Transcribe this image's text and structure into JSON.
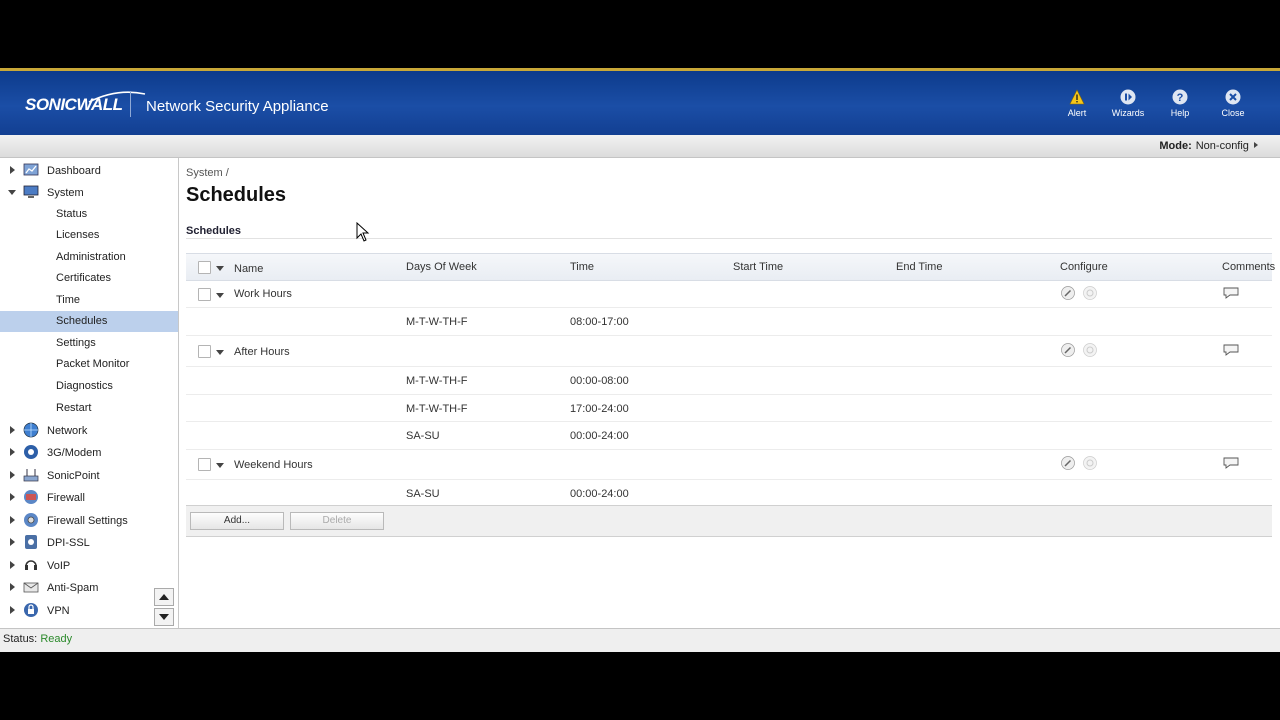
{
  "header": {
    "brand": "SONICWALL",
    "app_title": "Network Security Appliance",
    "buttons": [
      {
        "label": "Alert",
        "icon": "alert-icon"
      },
      {
        "label": "Wizards",
        "icon": "wizards-icon"
      },
      {
        "label": "Help",
        "icon": "help-icon"
      },
      {
        "label": "Close",
        "icon": "close-icon"
      }
    ]
  },
  "modebar": {
    "label": "Mode:",
    "value": "Non-config"
  },
  "sidebar": {
    "items": [
      {
        "label": "Dashboard",
        "icon": "dashboard-icon",
        "expanded": false
      },
      {
        "label": "System",
        "icon": "system-icon",
        "expanded": true,
        "children": [
          "Status",
          "Licenses",
          "Administration",
          "Certificates",
          "Time",
          "Schedules",
          "Settings",
          "Packet Monitor",
          "Diagnostics",
          "Restart"
        ],
        "active_child": "Schedules"
      },
      {
        "label": "Network",
        "icon": "network-icon",
        "expanded": false
      },
      {
        "label": "3G/Modem",
        "icon": "modem-icon",
        "expanded": false
      },
      {
        "label": "SonicPoint",
        "icon": "sonicpoint-icon",
        "expanded": false
      },
      {
        "label": "Firewall",
        "icon": "firewall-icon",
        "expanded": false
      },
      {
        "label": "Firewall Settings",
        "icon": "firewall-settings-icon",
        "expanded": false
      },
      {
        "label": "DPI-SSL",
        "icon": "dpi-ssl-icon",
        "expanded": false
      },
      {
        "label": "VoIP",
        "icon": "voip-icon",
        "expanded": false
      },
      {
        "label": "Anti-Spam",
        "icon": "anti-spam-icon",
        "expanded": false
      },
      {
        "label": "VPN",
        "icon": "vpn-icon",
        "expanded": false
      }
    ]
  },
  "main": {
    "breadcrumb": "System /",
    "title": "Schedules",
    "section_title": "Schedules",
    "table": {
      "columns": [
        "Name",
        "Days Of Week",
        "Time",
        "Start Time",
        "End Time",
        "Configure",
        "Comments"
      ],
      "groups": [
        {
          "name": "Work Hours",
          "entries": [
            {
              "days": "M-T-W-TH-F",
              "time": "08:00-17:00"
            }
          ]
        },
        {
          "name": "After Hours",
          "entries": [
            {
              "days": "M-T-W-TH-F",
              "time": "00:00-08:00"
            },
            {
              "days": "M-T-W-TH-F",
              "time": "17:00-24:00"
            },
            {
              "days": "SA-SU",
              "time": "00:00-24:00"
            }
          ]
        },
        {
          "name": "Weekend Hours",
          "entries": [
            {
              "days": "SA-SU",
              "time": "00:00-24:00"
            }
          ]
        }
      ]
    },
    "buttons": {
      "add": "Add...",
      "delete": "Delete"
    }
  },
  "status": {
    "label": "Status:",
    "value": "Ready"
  },
  "colors": {
    "header": "#1b4ea6",
    "accent_line": "#c9a838",
    "active_row": "#bcd0ec",
    "ready": "#2b8a2b"
  }
}
